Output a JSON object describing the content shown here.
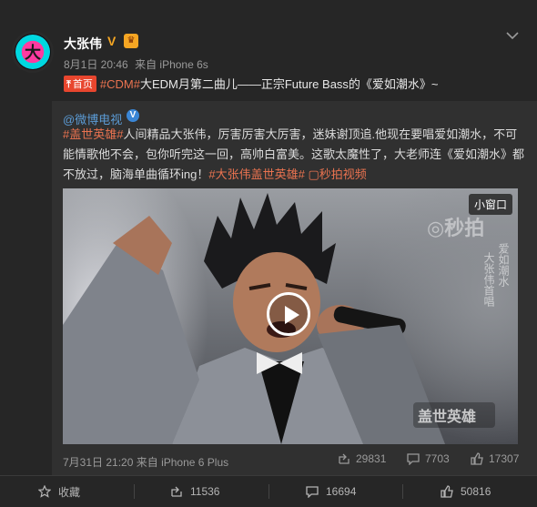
{
  "post": {
    "author": "大张伟",
    "time": "8月1日 20:46",
    "source": "来自 iPhone 6s",
    "home_tag": "首页",
    "headline_tags": "#CDM#",
    "headline_text": "大EDM月第二曲儿——正宗Future Bass的《爱如潮水》~"
  },
  "repost": {
    "author": "@微博电视",
    "text_tag1": "#盖世英雄#",
    "text_body": "人间精品大张伟，厉害厉害大厉害，迷妹谢顶追.他现在要唱爱如潮水，不可能情歌他不会，包你听完这一回，高帅白富美。这歌太魔性了，大老师连《爱如潮水》都不放过，脑海单曲循环ing！",
    "text_tag2": "#大张伟盖世英雄#",
    "video_link": "秒拍视频",
    "video": {
      "mini_window": "小窗口",
      "watermark": "秒拍"
    },
    "time": "7月31日 21:20",
    "source": "来自 iPhone 6 Plus",
    "reposts": "29831",
    "comments": "7703",
    "likes": "17307"
  },
  "bottom": {
    "favorite": "收藏",
    "reposts": "11536",
    "comments": "16694",
    "likes": "50816"
  },
  "colors": {
    "tag": "#eb7350",
    "link": "#5b9bd5",
    "home_tag_bg": "#e8462e"
  }
}
